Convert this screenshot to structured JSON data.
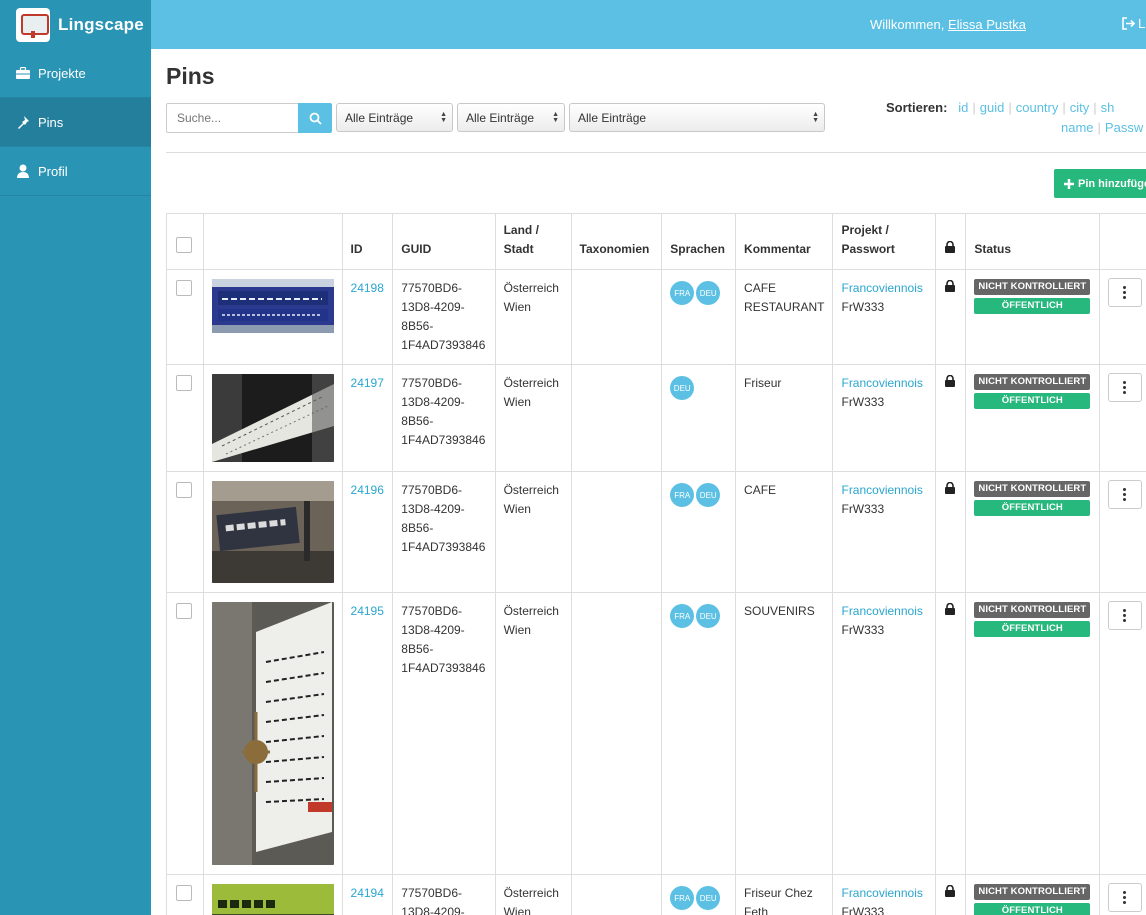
{
  "app": {
    "name": "Lingscape"
  },
  "header": {
    "welcome_text": "Willkommen, ",
    "user_name": "Elissa Pustka",
    "logout_label": "L"
  },
  "sidebar": {
    "items": [
      {
        "label": "Projekte",
        "icon": "briefcase-icon"
      },
      {
        "label": "Pins",
        "icon": "pin-icon"
      },
      {
        "label": "Profil",
        "icon": "user-icon"
      }
    ]
  },
  "page": {
    "title": "Pins"
  },
  "filters": {
    "search_placeholder": "Suche...",
    "select1": "Alle Einträge",
    "select2": "Alle Einträge",
    "select3": "Alle Einträge"
  },
  "sort": {
    "label": "Sortieren:",
    "row1": [
      "id",
      "guid",
      "country",
      "city",
      "sh"
    ],
    "row2": [
      "name",
      "Passw"
    ]
  },
  "add_button": "Pin hinzufüge",
  "table": {
    "headers": {
      "id": "ID",
      "guid": "GUID",
      "land": "Land /",
      "stadt": "Stadt",
      "taxonomien": "Taxonomien",
      "sprachen": "Sprachen",
      "kommentar": "Kommentar",
      "projekt": "Projekt /",
      "passwort": "Passwort",
      "status": "Status"
    },
    "rows": [
      {
        "id": "24198",
        "guid": [
          "77570BD6-",
          "13D8-4209-",
          "8B56-",
          "1F4AD7393846"
        ],
        "land": "Österreich",
        "stadt": "Wien",
        "sprachen": [
          "FRA",
          "DEU"
        ],
        "kommentar": "CAFE RESTAURANT",
        "projekt": "Francoviennois",
        "passwort": "FrW333",
        "status1": "NICHT KONTROLLIERT",
        "status2": "ÖFFENTLICH",
        "thumb": "sign-blue"
      },
      {
        "id": "24197",
        "guid": [
          "77570BD6-",
          "13D8-4209-",
          "8B56-",
          "1F4AD7393846"
        ],
        "land": "Österreich",
        "stadt": "Wien",
        "sprachen": [
          "DEU"
        ],
        "kommentar": "Friseur",
        "projekt": "Francoviennois",
        "passwort": "FrW333",
        "status1": "NICHT KONTROLLIERT",
        "status2": "ÖFFENTLICH",
        "thumb": "sign-white"
      },
      {
        "id": "24196",
        "guid": [
          "77570BD6-",
          "13D8-4209-",
          "8B56-",
          "1F4AD7393846"
        ],
        "land": "Österreich",
        "stadt": "Wien",
        "sprachen": [
          "FRA",
          "DEU"
        ],
        "kommentar": "CAFE",
        "projekt": "Francoviennois",
        "passwort": "FrW333",
        "status1": "NICHT KONTROLLIERT",
        "status2": "ÖFFENTLICH",
        "thumb": "sign-rossi"
      },
      {
        "id": "24195",
        "guid": [
          "77570BD6-",
          "13D8-4209-",
          "8B56-",
          "1F4AD7393846"
        ],
        "land": "Österreich",
        "stadt": "Wien",
        "sprachen": [
          "FRA",
          "DEU"
        ],
        "kommentar": "SOUVENIRS",
        "projekt": "Francoviennois",
        "passwort": "FrW333",
        "status1": "NICHT KONTROLLIERT",
        "status2": "ÖFFENTLICH",
        "thumb": "sign-hannabal"
      },
      {
        "id": "24194",
        "guid": [
          "77570BD6-",
          "13D8-4209-",
          "",
          ""
        ],
        "land": "Österreich",
        "stadt": "Wien",
        "sprachen": [
          "FRA",
          "DEU"
        ],
        "kommentar": "Friseur Chez Feth",
        "projekt": "Francoviennois",
        "passwort": "FrW333",
        "status1": "NICHT KONTROLLIERT",
        "status2": "ÖFFENTLICH",
        "thumb": "sign-friseur"
      }
    ]
  },
  "colors": {
    "accent": "#5bc0e3",
    "sidebar": "#2a94b4",
    "success": "#26b87c",
    "badge_gray": "#666666"
  }
}
